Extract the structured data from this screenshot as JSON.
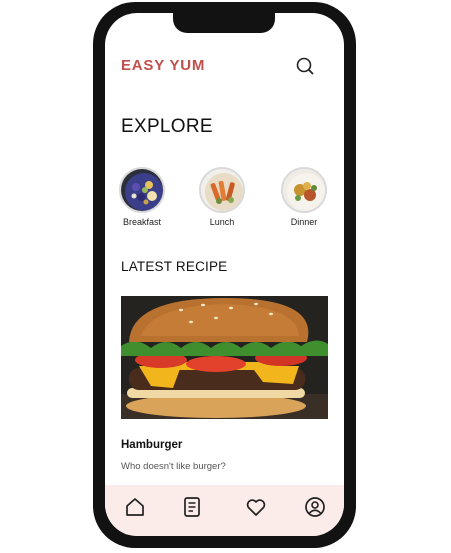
{
  "app": {
    "brand": "EASY YUM"
  },
  "explore": {
    "title": "EXPLORE",
    "categories": [
      {
        "label": "Breakfast"
      },
      {
        "label": "Lunch"
      },
      {
        "label": "Dinner"
      }
    ]
  },
  "latest": {
    "title": "LATEST RECIPE",
    "recipe": {
      "name": "Hamburger",
      "description": "Who doesn't like burger?"
    }
  },
  "bottom_nav": {
    "icons": [
      "home-icon",
      "recipe-book-icon",
      "heart-icon",
      "profile-icon"
    ]
  },
  "colors": {
    "brand": "#c0504d",
    "nav_background": "#fbecea",
    "frame": "#121212"
  }
}
